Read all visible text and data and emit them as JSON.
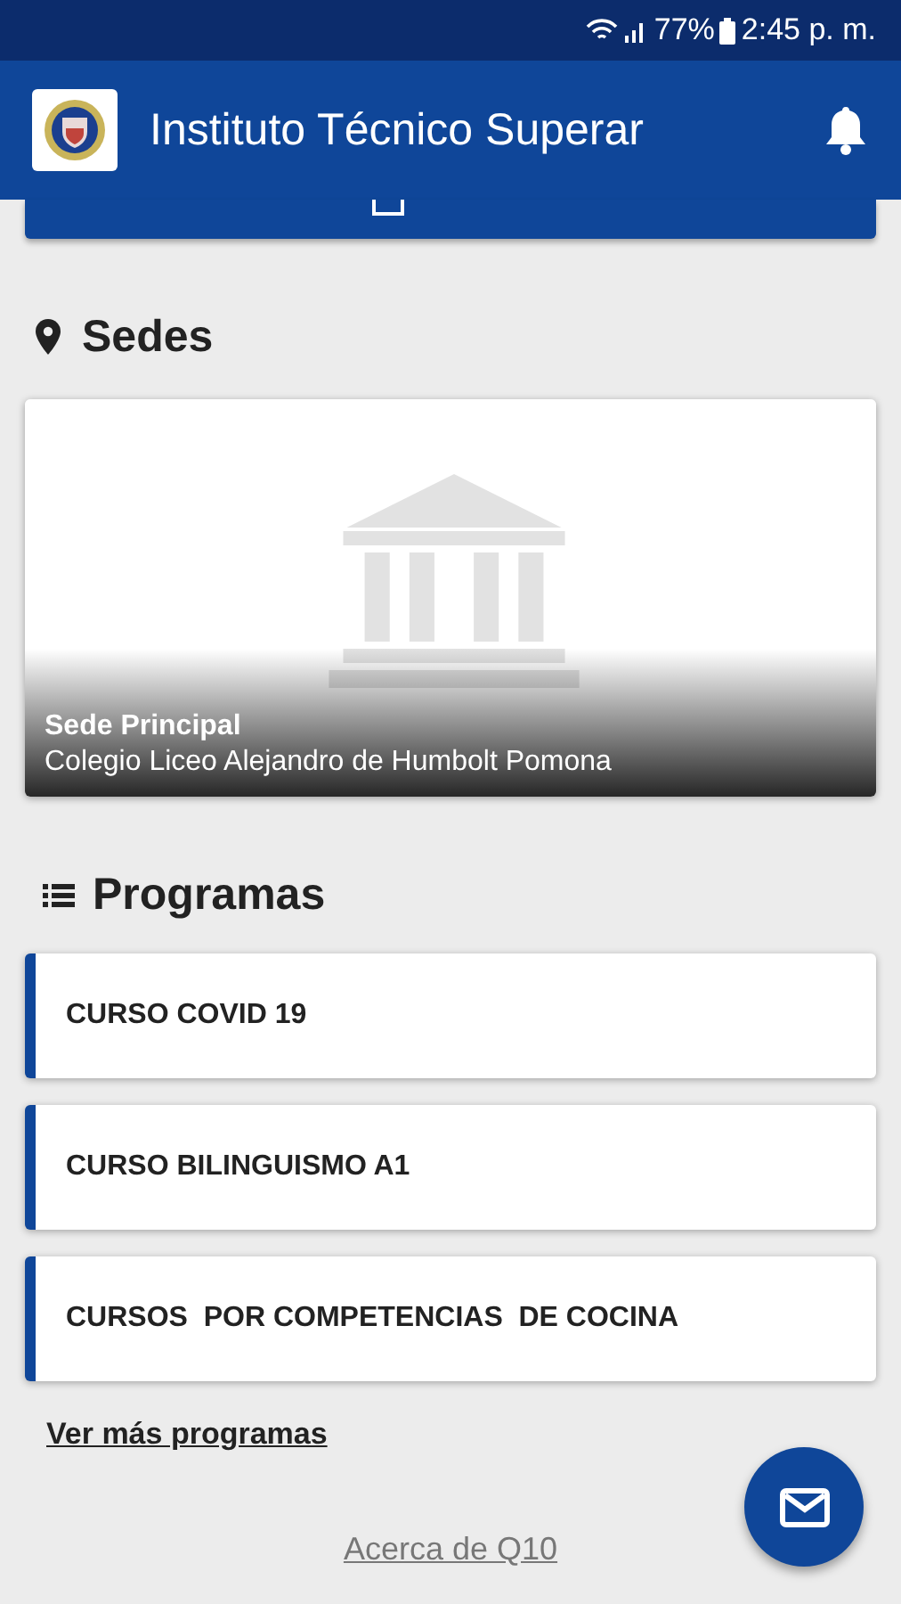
{
  "status_bar": {
    "battery": "77%",
    "time": "2:45 p. m."
  },
  "app_bar": {
    "title": "Instituto Técnico Superar"
  },
  "sedes": {
    "heading": "Sedes",
    "cards": [
      {
        "kind": "picture",
        "name": "Sede Principal",
        "address": "Colegio Liceo Alejandro de Humbolt Pomona"
      }
    ]
  },
  "programas": {
    "heading": "Programas",
    "items": [
      {
        "name": "CURSO COVID 19"
      },
      {
        "name": "CURSO BILINGUISMO A1"
      },
      {
        "name": "CURSOS  POR COMPETENCIAS  DE COCINA"
      }
    ],
    "more_link": "Ver más programas"
  },
  "footer_link": "Acerca de Q10"
}
